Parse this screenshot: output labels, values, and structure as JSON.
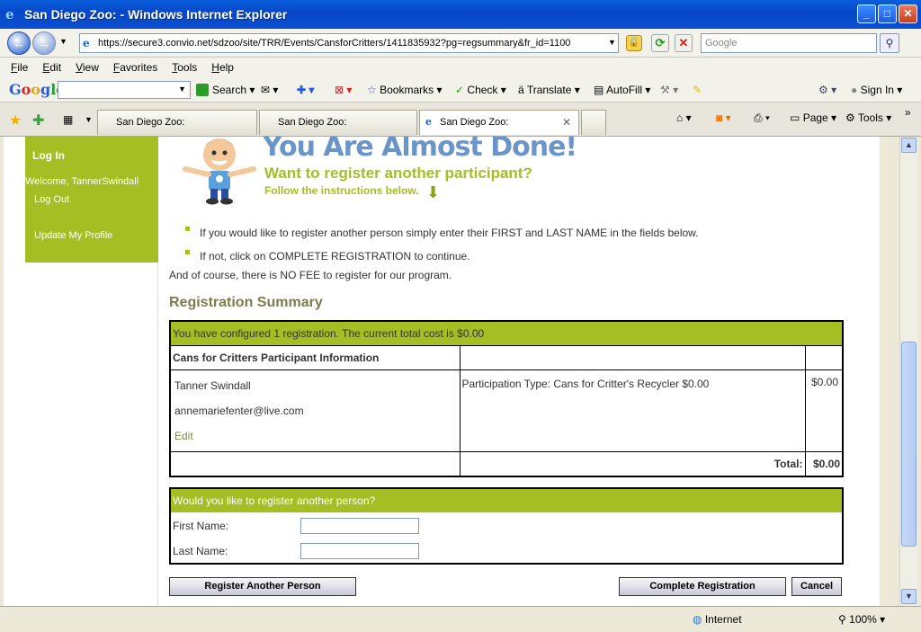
{
  "window": {
    "title": "San Diego Zoo: - Windows Internet Explorer"
  },
  "address": {
    "url": "https://secure3.convio.net/sdzoo/site/TRR/Events/CansforCritters/1411835932?pg=regsummary&fr_id=1100"
  },
  "search_box": {
    "placeholder": "Google"
  },
  "menu": [
    "File",
    "Edit",
    "View",
    "Favorites",
    "Tools",
    "Help"
  ],
  "google_bar": {
    "logo": "Google",
    "items": {
      "search": "Search",
      "bookmarks": "Bookmarks",
      "check": "Check",
      "translate": "Translate",
      "autofill": "AutoFill",
      "signin": "Sign In"
    }
  },
  "tabs": [
    {
      "label": "San Diego Zoo:"
    },
    {
      "label": "San Diego Zoo:"
    },
    {
      "label": "San Diego Zoo:"
    }
  ],
  "command_bar": {
    "page": "Page",
    "tools": "Tools"
  },
  "sidebar": {
    "login": "Log In",
    "welcome": "Welcome, TannerSwindall",
    "logout": "Log Out",
    "profile": "Update My Profile"
  },
  "hero": {
    "title": "You Are Almost Done!",
    "subtitle": "Want to register another participant?",
    "follow": "Follow the instructions below."
  },
  "bullets": [
    "If you would like to register another person simply enter their FIRST and LAST NAME in the fields below.",
    "If not, click on COMPLETE REGISTRATION to continue."
  ],
  "nofee": "And of course, there is NO FEE to register for our program.",
  "summary": {
    "heading": "Registration Summary",
    "configured": "You have configured 1 registration. The current total cost is $0.00",
    "section": "Cans for Critters Participant Information",
    "name": "Tanner Swindall",
    "email": "annemariefenter@live.com",
    "edit": "Edit",
    "participation": "Participation Type: Cans for Critter's Recycler $0.00",
    "price": "$0.00",
    "total_label": "Total:",
    "total_value": "$0.00"
  },
  "another": {
    "question": "Would you like to register another person?",
    "first_label": "First Name:",
    "last_label": "Last Name:",
    "first_value": "",
    "last_value": ""
  },
  "buttons": {
    "register_another": "Register Another Person",
    "complete": "Complete Registration",
    "cancel": "Cancel"
  },
  "status": {
    "zone": "Internet",
    "zoom": "100%"
  },
  "colors": {
    "accent_green": "#a4be24",
    "title_blue": "#6a95c8",
    "xp_blue": "#0a5fdc"
  }
}
